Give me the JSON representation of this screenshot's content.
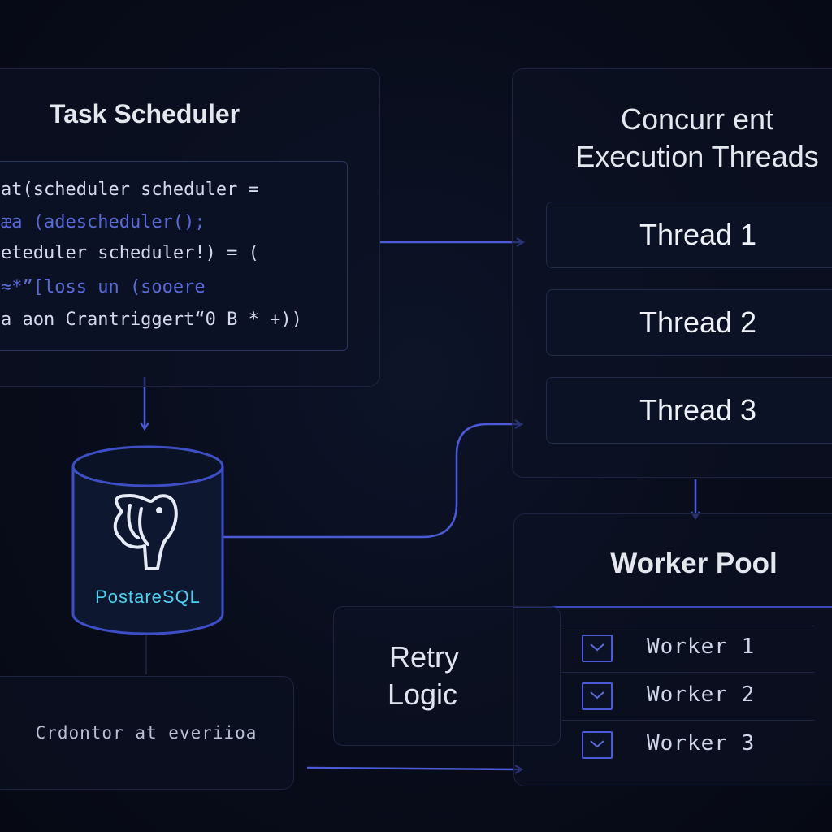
{
  "task_scheduler": {
    "title": "Task Scheduler",
    "code_lines": [
      "at(scheduler scheduler =",
      "æa (adescheduler();",
      "eteduler scheduler!) = (",
      "≈*”[loss un (sooere",
      "a aon Crantriggert“0 B * +))"
    ]
  },
  "threads": {
    "title_line1": "Concurr ent",
    "title_line2": "Execution Threads",
    "items": [
      "Thread 1",
      "Thread 2",
      "Thread 3"
    ]
  },
  "database": {
    "label": "PostareSQL",
    "icon": "postgresql-elephant-icon"
  },
  "worker_pool": {
    "title": "Worker Pool",
    "items": [
      "Worker 1",
      "Worker 2",
      "Worker 3"
    ]
  },
  "retry": {
    "line1": "Retry",
    "line2": "Logic"
  },
  "cron_note": "Crdontor at everiioa",
  "colors": {
    "accent": "#4b5ad6",
    "background": "#080c1a",
    "panel_border": "#1c2440",
    "db_label": "#4fd2f0"
  }
}
